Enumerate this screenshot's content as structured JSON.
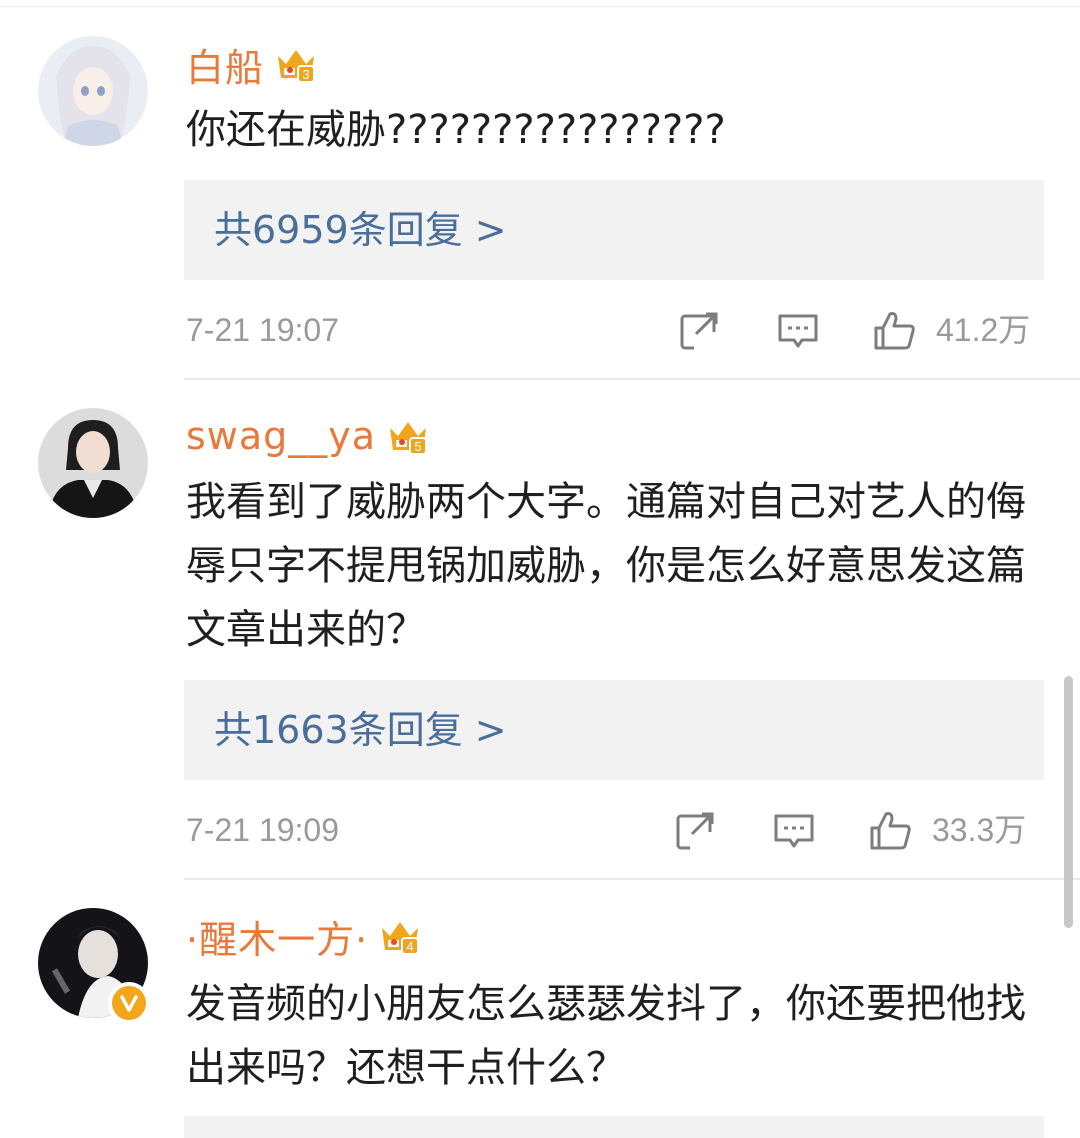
{
  "comments": [
    {
      "username": "白船",
      "level": "3",
      "text": "你还在威胁????????????????",
      "replies": "共6959条回复 >",
      "time": "7-21 19:07",
      "likes": "41.2万"
    },
    {
      "username": "swag__ya",
      "level": "5",
      "text": "我看到了威胁两个大字。通篇对自己对艺人的侮辱只字不提甩锅加威胁，你是怎么好意思发这篇文章出来的？",
      "replies": "共1663条回复 >",
      "time": "7-21 19:09",
      "likes": "33.3万"
    },
    {
      "username": "·醒木一方·",
      "level": "4",
      "text": "发音频的小朋友怎么瑟瑟发抖了，你还要把他找出来吗？还想干点什么？",
      "verified": true
    }
  ],
  "colors": {
    "username": "#e8793a",
    "reply_link": "#4a6e9a",
    "meta": "#9a9a9a",
    "crown": "#f0a61c",
    "verified": "#f3a51c"
  },
  "icons": [
    "crown-level-icon",
    "share-icon",
    "comment-icon",
    "like-icon",
    "verified-icon"
  ]
}
